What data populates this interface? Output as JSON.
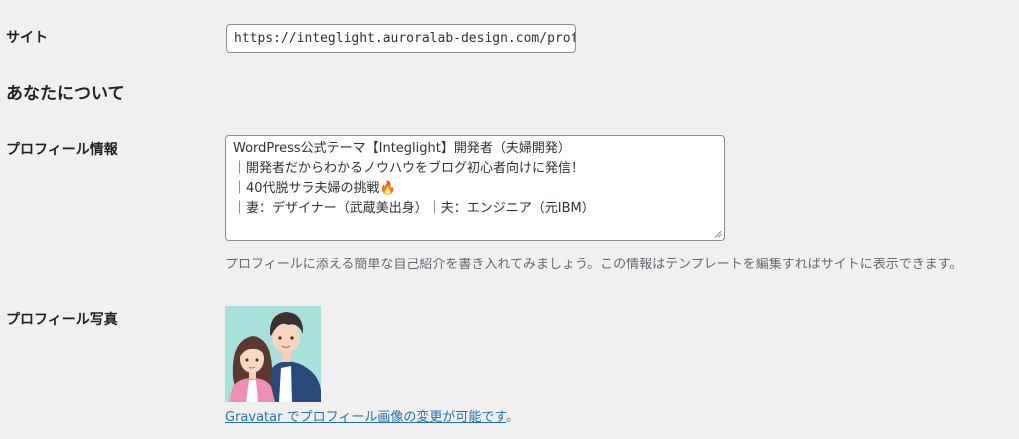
{
  "site": {
    "label": "サイト",
    "value": "https://integlight.auroralab-design.com/profile"
  },
  "about": {
    "heading": "あなたについて"
  },
  "bio": {
    "label": "プロフィール情報",
    "lines": [
      "WordPress公式テーマ【Integlight】開発者（夫婦開発）",
      "｜開発者だからわかるノウハウをブログ初心者向けに発信！",
      "｜40代脱サラ夫婦の挑戦🔥",
      "｜妻：デザイナー（武蔵美出身）｜夫：エンジニア（元IBM）"
    ],
    "description": "プロフィールに添える簡単な自己紹介を書き入れてみましょう。この情報はテンプレートを編集すればサイトに表示できます。"
  },
  "photo": {
    "label": "プロフィール写真",
    "gravatar_link": "Gravatar でプロフィール画像の変更が可能です",
    "gravatar_suffix": "。"
  },
  "colors": {
    "background": "#f0f0f1",
    "link": "#2271b1",
    "avatar_bg": "#a8e0dc"
  }
}
